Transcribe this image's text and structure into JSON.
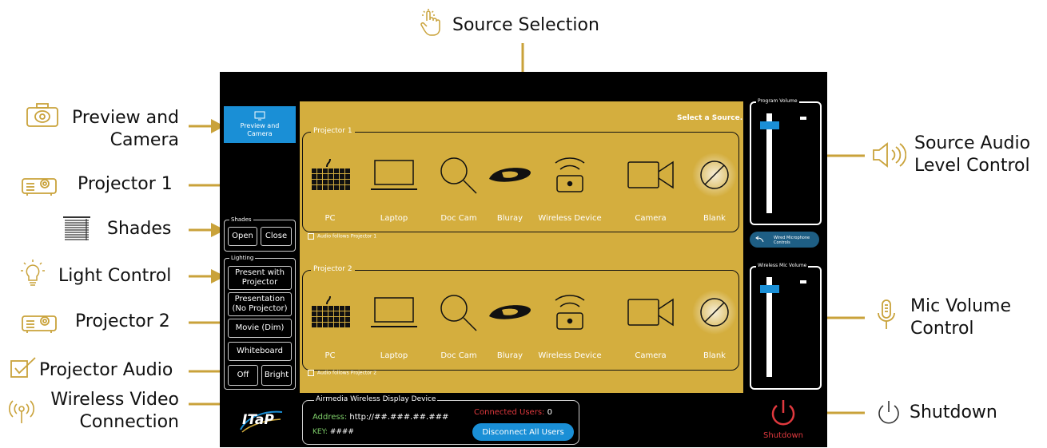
{
  "callouts": {
    "source_selection": "Source Selection",
    "preview_camera": [
      "Preview and",
      "Camera"
    ],
    "projector1": "Projector 1",
    "shades": "Shades",
    "light_control": "Light Control",
    "projector2": "Projector 2",
    "projector_audio": "Projector Audio",
    "wireless_video": [
      "Wireless Video",
      "Connection"
    ],
    "source_audio": [
      "Source Audio",
      "Level Control"
    ],
    "mic_volume": [
      "Mic Volume",
      "Control"
    ],
    "shutdown": "Shutdown"
  },
  "panel": {
    "preview_button": [
      "Preview and",
      "Camera"
    ],
    "select_source": "Select a Source.",
    "projector1": {
      "title": "Projector 1",
      "sources": [
        "PC",
        "Laptop",
        "Doc Cam",
        "Bluray",
        "Wireless Device",
        "Camera",
        "Blank"
      ],
      "audio_follows": "Audio follows Projector 1"
    },
    "projector2": {
      "title": "Projector 2",
      "sources": [
        "PC",
        "Laptop",
        "Doc Cam",
        "Bluray",
        "Wireless Device",
        "Camera",
        "Blank"
      ],
      "audio_follows": "Audio follows Projector 2"
    },
    "shades": {
      "title": "Shades",
      "open": "Open",
      "close": "Close"
    },
    "lighting": {
      "title": "Lighting",
      "buttons": [
        [
          "Present with",
          "Projector"
        ],
        [
          "Presentation",
          "(No Projector)"
        ],
        [
          "Movie (Dim)"
        ],
        [
          "Whiteboard"
        ]
      ],
      "off": "Off",
      "bright": "Bright"
    },
    "airmedia": {
      "title": "Airmedia Wireless Display Device",
      "address_label": "Address:",
      "address_value": "http://##.###.##.###",
      "key_label": "KEY:",
      "key_value": "####",
      "connected_label": "Connected Users:",
      "connected_value": "0",
      "disconnect": "Disconnect All Users"
    },
    "program_volume": {
      "title": "Program Volume",
      "level": 0.88
    },
    "wired_mic": [
      "Wired Microphone",
      "Controls"
    ],
    "wireless_mic_volume": {
      "title": "Wireless Mic Volume",
      "level": 0.88
    },
    "shutdown": "Shutdown",
    "logo": "ITaP"
  },
  "colors": {
    "gold": "#d4ae3e",
    "arrow": "#c9a23a",
    "blue": "#1a8fd6",
    "red": "#e0393e",
    "green_text": "#7fd06a"
  }
}
